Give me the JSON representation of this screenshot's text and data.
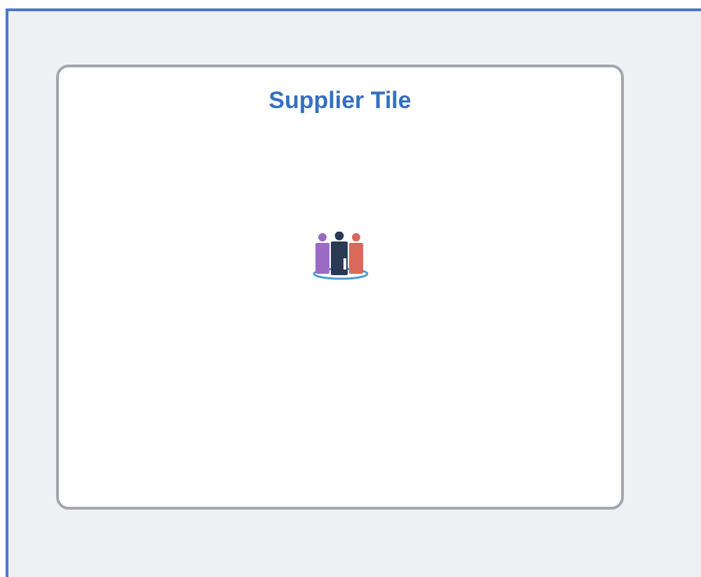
{
  "tile": {
    "title": "Supplier Tile"
  }
}
